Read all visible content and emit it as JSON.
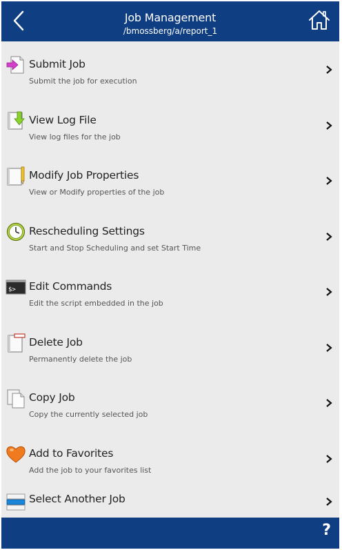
{
  "header": {
    "title": "Job Management",
    "subtitle": "/bmossberg/a/report_1",
    "back_icon": "chevron-left-icon",
    "home_icon": "home-icon"
  },
  "menu": [
    {
      "label": "Submit Job",
      "description": "Submit the job for execution",
      "icon": "submit-arrow-icon"
    },
    {
      "label": "View Log File",
      "description": "View log files for the job",
      "icon": "download-log-icon"
    },
    {
      "label": "Modify Job Properties",
      "description": "View or Modify properties of the job",
      "icon": "edit-properties-icon"
    },
    {
      "label": "Rescheduling Settings",
      "description": "Start and Stop Scheduling and set Start Time",
      "icon": "clock-icon"
    },
    {
      "label": "Edit Commands",
      "description": "Edit the script embedded in the job",
      "icon": "terminal-icon"
    },
    {
      "label": "Delete Job",
      "description": "Permanently delete the job",
      "icon": "delete-document-icon"
    },
    {
      "label": "Copy Job",
      "description": "Copy the currently selected job",
      "icon": "copy-documents-icon"
    },
    {
      "label": "Add to Favorites",
      "description": "Add the job to your favorites list",
      "icon": "heart-icon"
    },
    {
      "label": "Select Another Job",
      "description": "",
      "icon": "job-list-icon"
    }
  ],
  "footer": {
    "help_label": "?"
  },
  "colors": {
    "header_bg": "#0f3f82",
    "list_bg": "#ebebeb"
  }
}
